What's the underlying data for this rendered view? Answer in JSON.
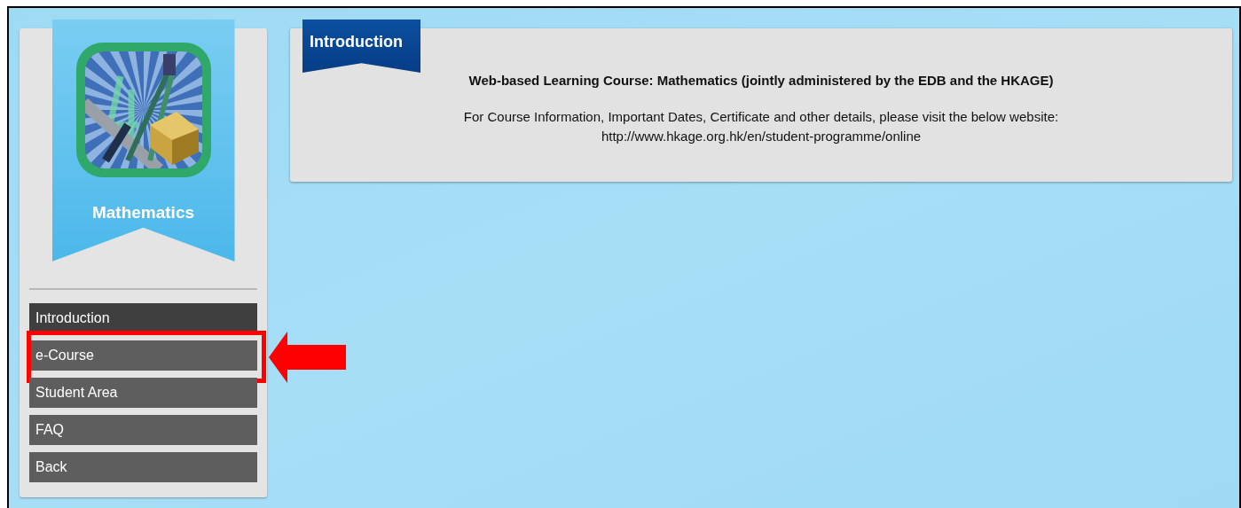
{
  "subject": {
    "title": "Mathematics"
  },
  "nav": [
    {
      "label": "Introduction",
      "selected": true,
      "annotated": false
    },
    {
      "label": "e-Course",
      "selected": false,
      "annotated": true
    },
    {
      "label": "Student Area",
      "selected": false,
      "annotated": false
    },
    {
      "label": "FAQ",
      "selected": false,
      "annotated": false
    },
    {
      "label": "Back",
      "selected": false,
      "annotated": false
    }
  ],
  "content": {
    "tab": "Introduction",
    "heading": "Web-based Learning Course: Mathematics (jointly administered by the EDB and the HKAGE)",
    "body": "For Course Information, Important Dates, Certificate and other details, please visit the below website:",
    "link": "http://www.hkage.org.hk/en/student-programme/online"
  }
}
